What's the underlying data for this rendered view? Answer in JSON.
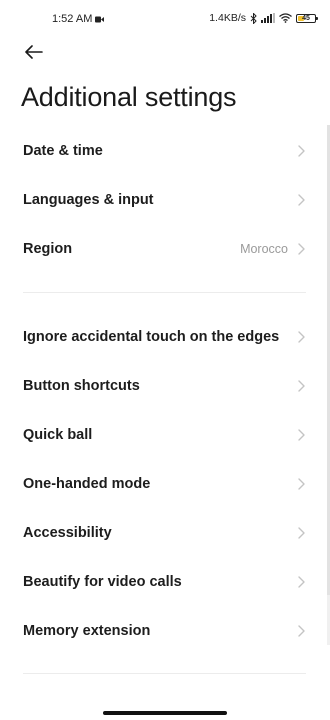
{
  "status_bar": {
    "time": "1:52 AM",
    "speed": "1.4KB/s",
    "battery_text": "45",
    "battery_level_percent": 45,
    "battery_color": "#f2c230"
  },
  "header": {
    "back_icon": "arrow-left-icon",
    "title": "Additional settings"
  },
  "groups": [
    {
      "items": [
        {
          "id": "date-time",
          "label": "Date & time",
          "value": ""
        },
        {
          "id": "languages-input",
          "label": "Languages & input",
          "value": ""
        },
        {
          "id": "region",
          "label": "Region",
          "value": "Morocco"
        }
      ]
    },
    {
      "items": [
        {
          "id": "ignore-touch",
          "label": "Ignore accidental touch on the edges",
          "value": ""
        },
        {
          "id": "button-shortcuts",
          "label": "Button shortcuts",
          "value": ""
        },
        {
          "id": "quick-ball",
          "label": "Quick ball",
          "value": ""
        },
        {
          "id": "one-handed",
          "label": "One-handed mode",
          "value": ""
        },
        {
          "id": "accessibility",
          "label": "Accessibility",
          "value": ""
        },
        {
          "id": "beautify",
          "label": "Beautify for video calls",
          "value": ""
        },
        {
          "id": "memory-extension",
          "label": "Memory extension",
          "value": ""
        }
      ]
    }
  ],
  "colors": {
    "chevron": "#c4c4c4",
    "secondary_text": "#9a9a9a",
    "divider": "#ececec"
  }
}
